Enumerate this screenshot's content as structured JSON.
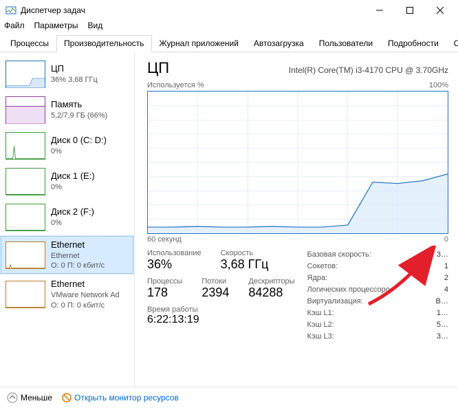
{
  "window": {
    "title": "Диспетчер задач"
  },
  "menu": {
    "file": "Файл",
    "options": "Параметры",
    "view": "Вид"
  },
  "tabs": {
    "processes": "Процессы",
    "performance": "Производительность",
    "apphistory": "Журнал приложений",
    "startup": "Автозагрузка",
    "users": "Пользователи",
    "details": "Подробности",
    "services": "Службы"
  },
  "sidebar": [
    {
      "title": "ЦП",
      "sub1": "36% 3,68 ГГц",
      "color": "#2071c4"
    },
    {
      "title": "Память",
      "sub1": "5,2/7,9 ГБ (66%)",
      "color": "#8a3d9c"
    },
    {
      "title": "Диск 0 (C: D:)",
      "sub1": "0%",
      "color": "#3c9b3c"
    },
    {
      "title": "Диск 1 (E:)",
      "sub1": "0%",
      "color": "#3c9b3c"
    },
    {
      "title": "Диск 2 (F:)",
      "sub1": "0%",
      "color": "#3c9b3c"
    },
    {
      "title": "Ethernet",
      "sub1": "Ethernet",
      "sub2": "О: 0 П: 0 кбит/с",
      "color": "#b87d2c"
    },
    {
      "title": "Ethernet",
      "sub1": "VMware Network Ad",
      "sub2": "О: 0 П: 0 кбит/с",
      "color": "#b87d2c"
    }
  ],
  "main": {
    "title": "ЦП",
    "sub": "Intel(R) Core(TM) i3-4170 CPU @ 3.70GHz",
    "y_label": "Используется %",
    "y_max": "100%",
    "x_left": "60 секунд",
    "x_right": "0"
  },
  "chart_data": {
    "type": "line",
    "title": "ЦП — Используется %",
    "xlabel": "60 секунд",
    "ylabel": "%",
    "ylim": [
      0,
      100
    ],
    "x_seconds_ago": [
      60,
      55,
      50,
      45,
      40,
      35,
      30,
      25,
      20,
      15,
      10,
      5,
      0
    ],
    "values": [
      4,
      4,
      5,
      4,
      4,
      5,
      4,
      4,
      6,
      36,
      35,
      37,
      42
    ]
  },
  "stats": {
    "usage_lab": "Использование",
    "usage_val": "36%",
    "speed_lab": "Скорость",
    "speed_val": "3,68 ГГц",
    "proc_lab": "Процессы",
    "proc_val": "178",
    "threads_lab": "Потоки",
    "threads_val": "2394",
    "handles_lab": "Дескрипторы",
    "handles_val": "84288",
    "uptime_lab": "Время работы",
    "uptime_val": "6:22:13:19"
  },
  "right": {
    "base_k": "Базовая скорость:",
    "base_v": "3…",
    "sockets_k": "Сокетов:",
    "sockets_v": "1",
    "cores_k": "Ядра:",
    "cores_v": "2",
    "logical_k": "Логических процессоро",
    "logical_v": "4",
    "virt_k": "Виртуализация:",
    "virt_v": "В…",
    "l1_k": "Кэш L1:",
    "l1_v": "1…",
    "l2_k": "Кэш L2:",
    "l2_v": "5…",
    "l3_k": "Кэш L3:",
    "l3_v": "3…"
  },
  "status": {
    "fewer": "Меньше",
    "monitor": "Открыть монитор ресурсов"
  }
}
